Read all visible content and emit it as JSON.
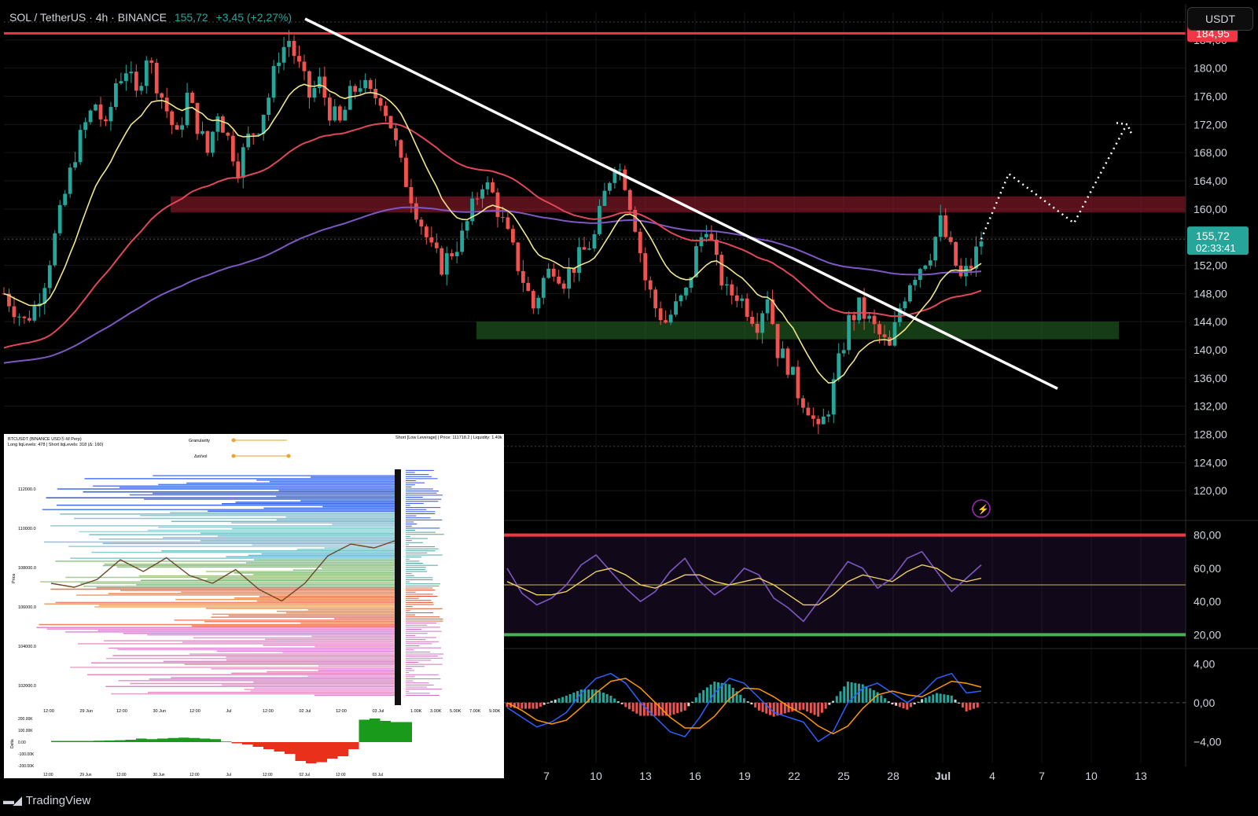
{
  "header": {
    "title": "SOL / TetherUS · 4h · BINANCE",
    "price": "155,72",
    "change": "+3,45 (+2,27%)"
  },
  "currency_button": "USDT",
  "brand": "TradingView",
  "price_axis": {
    "ticks": [
      "184,00",
      "180,00",
      "176,00",
      "172,00",
      "168,00",
      "164,00",
      "160,00",
      "156,00",
      "152,00",
      "148,00",
      "144,00",
      "140,00",
      "136,00",
      "132,00",
      "128,00",
      "124,00",
      "120,00"
    ],
    "tick_values": [
      184,
      180,
      176,
      172,
      168,
      164,
      160,
      156,
      152,
      148,
      144,
      140,
      136,
      132,
      128,
      124,
      120
    ],
    "resistance_label": "184,95",
    "current_label": "155,72",
    "countdown_label": "02:33:41"
  },
  "time_axis": {
    "labels": [
      "7",
      "10",
      "13",
      "16",
      "19",
      "22",
      "25",
      "28",
      "Jul",
      "4",
      "7",
      "10",
      "13"
    ]
  },
  "rsi_axis": {
    "ticks": [
      "80,00",
      "60,00",
      "40,00",
      "20,00"
    ]
  },
  "macd_axis": {
    "ticks": [
      "4,00",
      "0,00",
      "−4,00"
    ]
  },
  "inset": {
    "title": "BTCUSDT (BINANCE USDⓈ-M Perp)",
    "subtitle": "Long liqLevels: 478 | Short liqLevels: 318 (Δ: 160)",
    "granularity_label": "Granularity",
    "delta_label": "Δst/vol",
    "tooltip": "Short [Low Leverage] | Price: 111718.2 | Liquidity: 1.49k",
    "y_ticks": [
      "112000.0",
      "110000.0",
      "108000.0",
      "106000.0",
      "104000.0",
      "102000.0"
    ],
    "x_ticks": [
      "12:00",
      "29 Jun",
      "12:00",
      "30 Jun",
      "12:00",
      "Jul",
      "12:00",
      "02 Jul",
      "12:00",
      "03 Jul"
    ],
    "hist_ticks": [
      "1.00K",
      "3.00K",
      "5.00K",
      "7.00K",
      "9.00K"
    ],
    "delta_ticks": [
      "200.00K",
      "100.00K",
      "0.00",
      "-100.00K",
      "-200.00K"
    ],
    "price_axis_title": "Price",
    "delta_axis_title": "Delta"
  },
  "colors": {
    "up": "#26a69a",
    "down": "#ef5350",
    "resistance": "#f23645",
    "trend": "#ffffff",
    "ema_fast": "#f0e68c",
    "ema_mid": "#e0485a",
    "ema_slow": "#7e57c2",
    "rsi": "#7e57c2",
    "rsi_ma": "#f0d060",
    "macd": "#2962ff",
    "signal": "#ff9800"
  },
  "chart_data": [
    {
      "type": "candlestick",
      "title": "SOL / TetherUS · 4h · BINANCE",
      "ylim": [
        116,
        188
      ],
      "x_labels": [
        "7",
        "10",
        "13",
        "16",
        "19",
        "22",
        "25",
        "28",
        "Jul",
        "4",
        "7",
        "10",
        "13"
      ],
      "close_path": [
        [
          0,
          148
        ],
        [
          2,
          146
        ],
        [
          4,
          144
        ],
        [
          6,
          146
        ],
        [
          8,
          150
        ],
        [
          10,
          156
        ],
        [
          12,
          162
        ],
        [
          14,
          168
        ],
        [
          16,
          172
        ],
        [
          18,
          175
        ],
        [
          20,
          171
        ],
        [
          22,
          178
        ],
        [
          24,
          180
        ],
        [
          26,
          176
        ],
        [
          28,
          182
        ],
        [
          30,
          178
        ],
        [
          32,
          174
        ],
        [
          34,
          170
        ],
        [
          36,
          176
        ],
        [
          38,
          172
        ],
        [
          40,
          168
        ],
        [
          42,
          174
        ],
        [
          44,
          170
        ],
        [
          46,
          166
        ],
        [
          48,
          170
        ],
        [
          50,
          172
        ],
        [
          52,
          176
        ],
        [
          54,
          182
        ],
        [
          56,
          184
        ],
        [
          58,
          180
        ],
        [
          60,
          176
        ],
        [
          62,
          178
        ],
        [
          64,
          174
        ],
        [
          66,
          172
        ],
        [
          68,
          176
        ],
        [
          70,
          178
        ],
        [
          72,
          176
        ],
        [
          74,
          176
        ],
        [
          76,
          172
        ],
        [
          78,
          166
        ],
        [
          80,
          162
        ],
        [
          82,
          158
        ],
        [
          84,
          154
        ],
        [
          86,
          152
        ],
        [
          88,
          154
        ],
        [
          90,
          156
        ],
        [
          92,
          160
        ],
        [
          94,
          164
        ],
        [
          96,
          162
        ],
        [
          98,
          158
        ],
        [
          100,
          154
        ],
        [
          102,
          150
        ],
        [
          104,
          146
        ],
        [
          106,
          150
        ],
        [
          108,
          152
        ],
        [
          110,
          150
        ],
        [
          112,
          152
        ],
        [
          114,
          154
        ],
        [
          116,
          156
        ],
        [
          118,
          162
        ],
        [
          120,
          167
        ],
        [
          122,
          164
        ],
        [
          124,
          158
        ],
        [
          126,
          150
        ],
        [
          128,
          146
        ],
        [
          130,
          144
        ],
        [
          132,
          146
        ],
        [
          134,
          148
        ],
        [
          136,
          154
        ],
        [
          138,
          158
        ],
        [
          140,
          152
        ],
        [
          142,
          148
        ],
        [
          144,
          148
        ],
        [
          146,
          146
        ],
        [
          148,
          144
        ],
        [
          150,
          148
        ],
        [
          152,
          140
        ],
        [
          154,
          138
        ],
        [
          156,
          134
        ],
        [
          158,
          132
        ],
        [
          160,
          128
        ],
        [
          162,
          132
        ],
        [
          164,
          138
        ],
        [
          166,
          144
        ],
        [
          168,
          146
        ],
        [
          170,
          144
        ],
        [
          172,
          142
        ],
        [
          174,
          140
        ],
        [
          176,
          146
        ],
        [
          178,
          150
        ],
        [
          180,
          152
        ],
        [
          182,
          154
        ],
        [
          184,
          158
        ],
        [
          186,
          154
        ],
        [
          188,
          150
        ],
        [
          190,
          152
        ],
        [
          192,
          155.72
        ]
      ],
      "horizontal_levels": [
        {
          "value": 184.95,
          "label": "184,95"
        }
      ],
      "zones": [
        {
          "from": 159.5,
          "to": 161.8
        },
        {
          "from": 141.5,
          "to": 144.0
        }
      ],
      "trendline": [
        [
          0,
          187
        ],
        [
          1,
          134.5
        ]
      ],
      "projection": [
        [
          155.72
        ],
        [
          165
        ],
        [
          158
        ],
        [
          172
        ]
      ]
    },
    {
      "type": "line",
      "title": "RSI",
      "ylim": [
        15,
        85
      ],
      "levels": [
        80,
        50,
        20
      ],
      "series": [
        {
          "values": [
            60,
            45,
            38,
            42,
            50,
            62,
            68,
            58,
            48,
            40,
            46,
            58,
            66,
            52,
            44,
            50,
            60,
            56,
            42,
            36,
            28,
            40,
            52,
            64,
            60,
            48,
            54,
            66,
            70,
            58,
            46,
            54,
            62
          ]
        },
        {
          "values": [
            52,
            48,
            44,
            44,
            46,
            52,
            58,
            60,
            56,
            50,
            48,
            52,
            56,
            56,
            52,
            50,
            52,
            54,
            50,
            44,
            38,
            38,
            44,
            52,
            56,
            54,
            52,
            58,
            62,
            60,
            54,
            52,
            54
          ]
        }
      ]
    },
    {
      "type": "bar",
      "title": "MACD",
      "ylim": [
        -6,
        5
      ],
      "series": [
        {
          "values": [
            -0.5,
            -1.5,
            -2.5,
            -2,
            -1,
            1,
            2.5,
            3,
            2,
            0,
            -1.5,
            -3,
            -3.5,
            -1.5,
            1,
            2.5,
            2,
            0.5,
            -1,
            -1.5,
            -2,
            -4,
            -3,
            0,
            1.5,
            2,
            1,
            0,
            1,
            2.5,
            3,
            1,
            1.2
          ]
        },
        {
          "values": [
            0,
            -0.8,
            -1.8,
            -2.2,
            -1.8,
            -0.5,
            1,
            2.2,
            2.5,
            1.5,
            0,
            -1.5,
            -2.6,
            -2.6,
            -1.4,
            0.4,
            1.5,
            1.4,
            0.6,
            -0.4,
            -1.2,
            -2.4,
            -3.2,
            -2.4,
            -0.6,
            0.8,
            1.2,
            0.8,
            0.6,
            1.4,
            2.2,
            2,
            1.6
          ]
        }
      ]
    },
    {
      "type": "heatmap",
      "title": "BTCUSDT (BINANCE USDⓈ-M Perp)",
      "ylim": [
        101000,
        113000
      ]
    }
  ]
}
